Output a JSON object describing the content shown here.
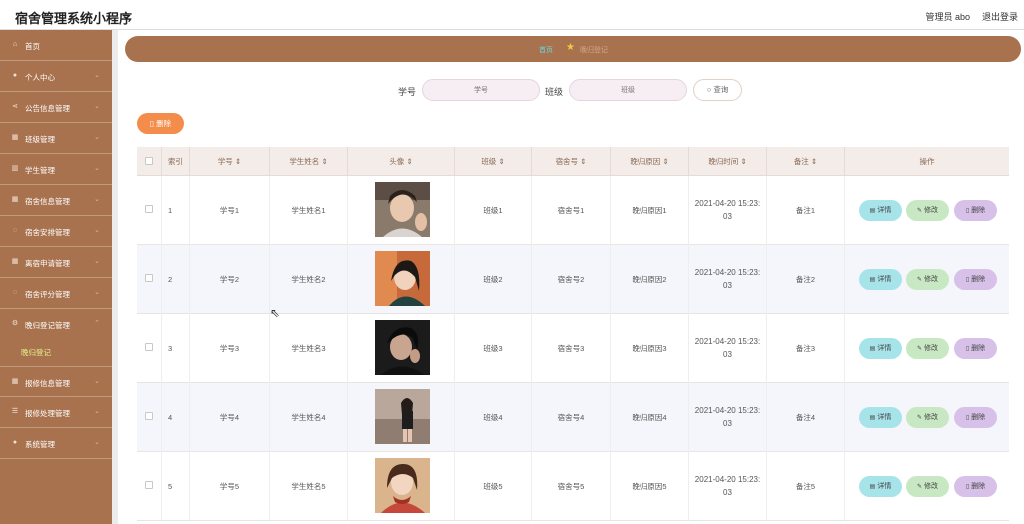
{
  "app": {
    "title": "宿舍管理系统小程序",
    "admin": "管理员 abo",
    "logout": "退出登录"
  },
  "sidebar": {
    "items": [
      {
        "label": "首页",
        "icon": "home-icon"
      },
      {
        "label": "个人中心",
        "icon": "user-icon"
      },
      {
        "label": "公告信息管理",
        "icon": "share-icon"
      },
      {
        "label": "班级管理",
        "icon": "grid-icon"
      },
      {
        "label": "学生管理",
        "icon": "chart-icon"
      },
      {
        "label": "宿舍信息管理",
        "icon": "grid-icon"
      },
      {
        "label": "宿舍安排管理",
        "icon": "chat-icon"
      },
      {
        "label": "离宿申请管理",
        "icon": "grid-icon"
      },
      {
        "label": "宿舍评分管理",
        "icon": "chat-icon"
      },
      {
        "label": "晚归登记管理",
        "icon": "settings-icon"
      },
      {
        "label": "报修信息管理",
        "icon": "grid-icon"
      },
      {
        "label": "报修处理管理",
        "icon": "list-icon"
      },
      {
        "label": "系统管理",
        "icon": "user-icon"
      }
    ],
    "active_sub": "晚归登记"
  },
  "breadcrumb": {
    "home": "首页",
    "current": "晚归登记"
  },
  "search": {
    "field1_label": "学号",
    "field1_placeholder": "学号",
    "field2_label": "班级",
    "field2_placeholder": "班级",
    "button": "查询"
  },
  "actions": {
    "delete": "删除"
  },
  "table": {
    "columns": [
      "索引",
      "学号",
      "学生姓名",
      "头像",
      "班级",
      "宿舍号",
      "晚归原因",
      "晚归时间",
      "备注",
      "操作"
    ],
    "rows": [
      {
        "index": "1",
        "sid": "学号1",
        "name": "学生姓名1",
        "cls": "班级1",
        "dorm": "宿舍号1",
        "reason": "晚归原因1",
        "time1": "2021-04-20 15:23:",
        "time2": "03",
        "note": "备注1"
      },
      {
        "index": "2",
        "sid": "学号2",
        "name": "学生姓名2",
        "cls": "班级2",
        "dorm": "宿舍号2",
        "reason": "晚归原因2",
        "time1": "2021-04-20 15:23:",
        "time2": "03",
        "note": "备注2"
      },
      {
        "index": "3",
        "sid": "学号3",
        "name": "学生姓名3",
        "cls": "班级3",
        "dorm": "宿舍号3",
        "reason": "晚归原因3",
        "time1": "2021-04-20 15:23:",
        "time2": "03",
        "note": "备注3"
      },
      {
        "index": "4",
        "sid": "学号4",
        "name": "学生姓名4",
        "cls": "班级4",
        "dorm": "宿舍号4",
        "reason": "晚归原因4",
        "time1": "2021-04-20 15:23:",
        "time2": "03",
        "note": "备注4"
      },
      {
        "index": "5",
        "sid": "学号5",
        "name": "学生姓名5",
        "cls": "班级5",
        "dorm": "宿舍号5",
        "reason": "晚归原因5",
        "time1": "2021-04-20 15:23:",
        "time2": "03",
        "note": "备注5"
      }
    ],
    "row_buttons": {
      "detail": "详情",
      "edit": "修改",
      "del": "删除"
    }
  }
}
